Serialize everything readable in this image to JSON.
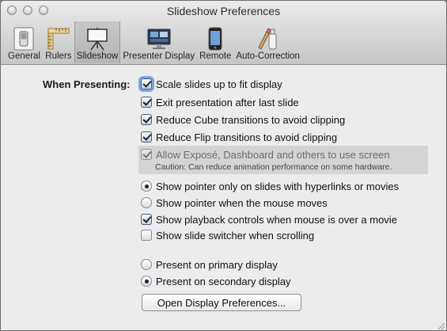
{
  "window": {
    "title": "Slideshow Preferences"
  },
  "tabs": [
    {
      "label": "General",
      "icon": "general-switch-icon",
      "selected": false
    },
    {
      "label": "Rulers",
      "icon": "rulers-icon",
      "selected": false
    },
    {
      "label": "Slideshow",
      "icon": "slideshow-easel-icon",
      "selected": true
    },
    {
      "label": "Presenter Display",
      "icon": "presenter-display-icon",
      "selected": false
    },
    {
      "label": "Remote",
      "icon": "remote-iphone-icon",
      "selected": false
    },
    {
      "label": "Auto-Correction",
      "icon": "auto-correction-icon",
      "selected": false
    }
  ],
  "presenting": {
    "section_label": "When Presenting:",
    "options": {
      "scale_slides": {
        "label": "Scale slides up to fit display",
        "checked": true
      },
      "exit_after_last": {
        "label": "Exit presentation after last slide",
        "checked": true
      },
      "reduce_cube": {
        "label": "Reduce Cube transitions to avoid clipping",
        "checked": true
      },
      "reduce_flip": {
        "label": "Reduce Flip transitions to avoid clipping",
        "checked": true
      },
      "allow_expose": {
        "label": "Allow Exposé, Dashboard and others to use screen",
        "checked": true,
        "caution": "Caution: Can reduce animation performance on some hardware."
      },
      "pointer_hyperlinks": {
        "label": "Show pointer only on slides with hyperlinks or movies",
        "selected": true
      },
      "pointer_mouse_moves": {
        "label": "Show pointer when the mouse moves",
        "selected": false
      },
      "playback_controls": {
        "label": "Show playback controls when mouse is over a movie",
        "checked": true
      },
      "slide_switcher": {
        "label": "Show slide switcher when scrolling",
        "checked": false
      },
      "primary_display": {
        "label": "Present on primary display",
        "selected": false
      },
      "secondary_display": {
        "label": "Present on secondary display",
        "selected": true
      }
    },
    "display_prefs_button": "Open Display Preferences..."
  },
  "colors": {
    "background": "#ececec",
    "focus_ring": "#5a8cdc",
    "selected_tab": "#bcbcbc"
  }
}
